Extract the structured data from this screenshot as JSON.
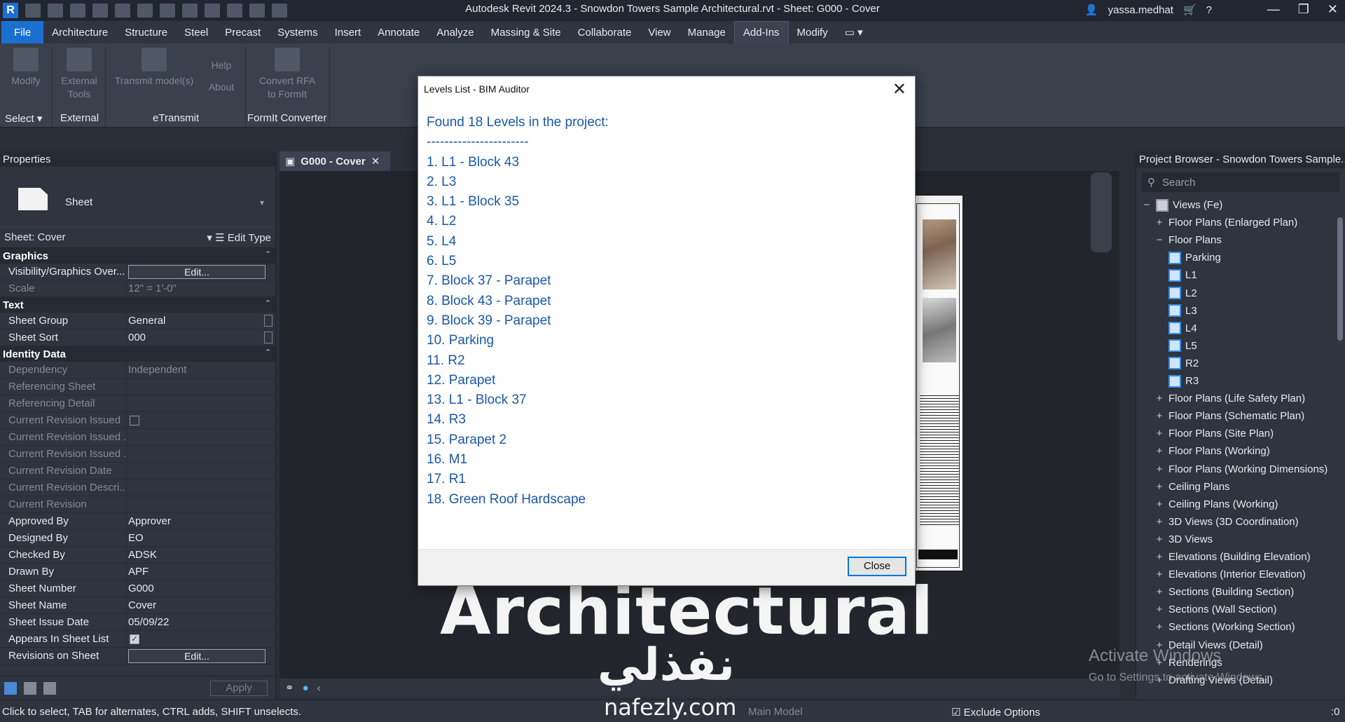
{
  "titlebar": {
    "title": "Autodesk Revit 2024.3 - Snowdon Towers Sample Architectural.rvt - Sheet: G000 - Cover",
    "user": "yassa.medhat",
    "logo": "R"
  },
  "menu": {
    "tabs": [
      "File",
      "Architecture",
      "Structure",
      "Steel",
      "Precast",
      "Systems",
      "Insert",
      "Annotate",
      "Analyze",
      "Massing & Site",
      "Collaborate",
      "View",
      "Manage",
      "Add-Ins",
      "Modify"
    ],
    "active": "Add-Ins"
  },
  "ribbon": {
    "modify": "Modify",
    "external_tools": "External Tools",
    "transmit": "Transmit model(s)",
    "help": "Help",
    "about": "About",
    "convert": "Convert RFA to FormIt",
    "panel_select": "Select",
    "panel_external": "External",
    "panel_etransmit": "eTransmit",
    "panel_formit": "FormIt Converter"
  },
  "properties": {
    "header": "Properties",
    "type_name": "Sheet",
    "instance": "Sheet: Cover",
    "edit_type": "Edit Type",
    "groups": {
      "graphics": "Graphics",
      "text": "Text",
      "identity": "Identity Data"
    },
    "rows": {
      "vis_k": "Visibility/Graphics Over...",
      "vis_v": "Edit...",
      "scale_k": "Scale",
      "scale_v": "12\" = 1'-0\"",
      "sgroup_k": "Sheet Group",
      "sgroup_v": "General",
      "ssort_k": "Sheet Sort",
      "ssort_v": "000",
      "dep_k": "Dependency",
      "dep_v": "Independent",
      "refsheet_k": "Referencing Sheet",
      "refdetail_k": "Referencing Detail",
      "cri_k": "Current Revision Issued",
      "crib_k": "Current Revision Issued ...",
      "crib2_k": "Current Revision Issued ...",
      "crd_k": "Current Revision Date",
      "crdesc_k": "Current Revision Descri...",
      "cr_k": "Current Revision",
      "appr_k": "Approved By",
      "appr_v": "Approver",
      "des_k": "Designed By",
      "des_v": "EO",
      "chk_k": "Checked By",
      "chk_v": "ADSK",
      "drawn_k": "Drawn By",
      "drawn_v": "APF",
      "num_k": "Sheet Number",
      "num_v": "G000",
      "name_k": "Sheet Name",
      "name_v": "Cover",
      "date_k": "Sheet Issue Date",
      "date_v": "05/09/22",
      "appears_k": "Appears In Sheet List",
      "revs_k": "Revisions on Sheet",
      "revs_v": "Edit..."
    },
    "apply": "Apply"
  },
  "view": {
    "tab_label": "G000 - Cover"
  },
  "browser": {
    "header": "Project Browser - Snowdon Towers Sample...",
    "search_placeholder": "Search",
    "items": [
      {
        "label": "Views (Fe)",
        "glyph": "−",
        "level": 0
      },
      {
        "label": "Floor Plans (Enlarged Plan)",
        "glyph": "+",
        "level": 1
      },
      {
        "label": "Floor Plans",
        "glyph": "−",
        "level": 1
      },
      {
        "label": "Parking",
        "glyph": "",
        "level": 2
      },
      {
        "label": "L1",
        "glyph": "",
        "level": 2
      },
      {
        "label": "L2",
        "glyph": "",
        "level": 2
      },
      {
        "label": "L3",
        "glyph": "",
        "level": 2
      },
      {
        "label": "L4",
        "glyph": "",
        "level": 2
      },
      {
        "label": "L5",
        "glyph": "",
        "level": 2
      },
      {
        "label": "R2",
        "glyph": "",
        "level": 2
      },
      {
        "label": "R3",
        "glyph": "",
        "level": 2
      },
      {
        "label": "Floor Plans (Life Safety Plan)",
        "glyph": "+",
        "level": 1
      },
      {
        "label": "Floor Plans (Schematic Plan)",
        "glyph": "+",
        "level": 1
      },
      {
        "label": "Floor Plans (Site Plan)",
        "glyph": "+",
        "level": 1
      },
      {
        "label": "Floor Plans (Working)",
        "glyph": "+",
        "level": 1
      },
      {
        "label": "Floor Plans (Working Dimensions)",
        "glyph": "+",
        "level": 1
      },
      {
        "label": "Ceiling Plans",
        "glyph": "+",
        "level": 1
      },
      {
        "label": "Ceiling Plans (Working)",
        "glyph": "+",
        "level": 1
      },
      {
        "label": "3D Views (3D Coordination)",
        "glyph": "+",
        "level": 1
      },
      {
        "label": "3D Views",
        "glyph": "+",
        "level": 1
      },
      {
        "label": "Elevations (Building Elevation)",
        "glyph": "+",
        "level": 1
      },
      {
        "label": "Elevations (Interior Elevation)",
        "glyph": "+",
        "level": 1
      },
      {
        "label": "Sections (Building Section)",
        "glyph": "+",
        "level": 1
      },
      {
        "label": "Sections (Wall Section)",
        "glyph": "+",
        "level": 1
      },
      {
        "label": "Sections (Working Section)",
        "glyph": "+",
        "level": 1
      },
      {
        "label": "Detail Views (Detail)",
        "glyph": "+",
        "level": 1
      },
      {
        "label": "Renderings",
        "glyph": "+",
        "level": 1
      },
      {
        "label": "Drafting Views (Detail)",
        "glyph": "+",
        "level": 1
      }
    ]
  },
  "dialog": {
    "title": "Levels List - BIM Auditor",
    "heading": "Found 18 Levels in the project:",
    "divider": "-----------------------",
    "levels": [
      "1. L1 - Block 43",
      "2. L3",
      "3. L1 - Block 35",
      "4. L2",
      "5. L4",
      "6. L5",
      "7. Block 37 - Parapet",
      "8. Block 43 - Parapet",
      "9. Block 39 - Parapet",
      "10. Parking",
      "11. R2",
      "12. Parapet",
      "13. L1 - Block 37",
      "14. R3",
      "15. Parapet 2",
      "16. M1",
      "17. R1",
      "18. Green Roof Hardscape"
    ],
    "close_label": "Close"
  },
  "status": {
    "message": "Click to select, TAB for alternates, CTRL adds, SHIFT unselects.",
    "model": "Main Model",
    "exclude": "Exclude Options",
    "filter_count": ":0"
  },
  "watermark": {
    "big": "Architectural",
    "arabic": "نفذلي",
    "site": "nafezly.com",
    "activate": "Activate Windows",
    "activate_sub": "Go to Settings to activate Windows."
  }
}
